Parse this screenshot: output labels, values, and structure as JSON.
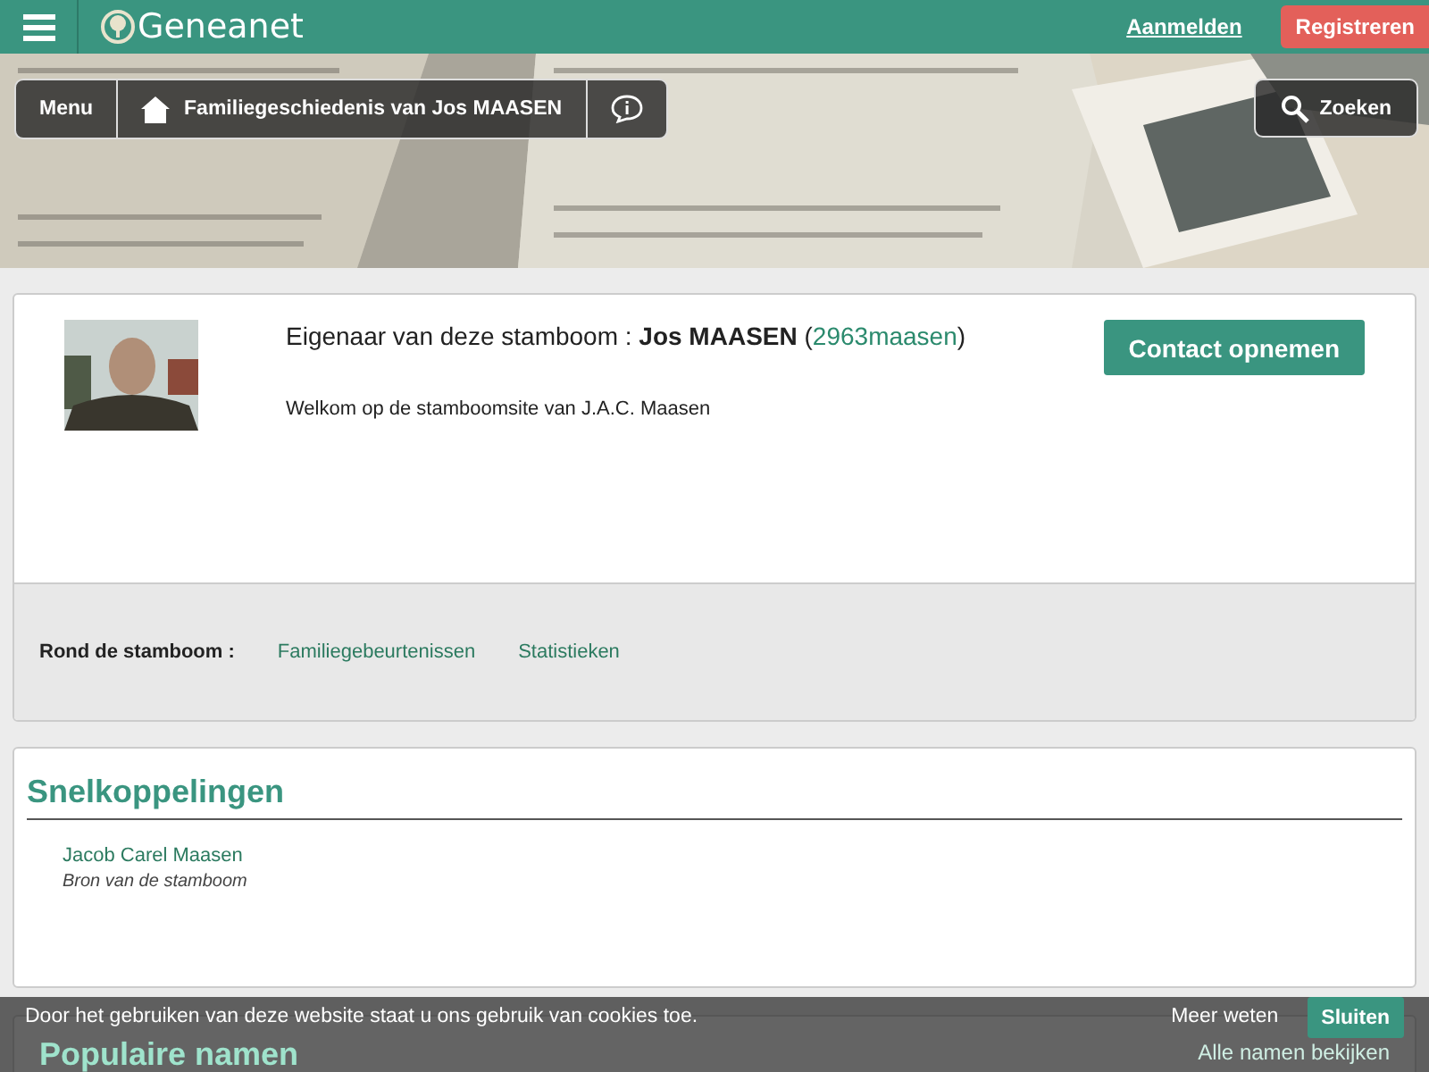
{
  "header": {
    "logo": "Geneanet",
    "login": "Aanmelden",
    "register": "Registreren"
  },
  "banner": {
    "menu": "Menu",
    "tree_title": "Familiegeschiedenis van Jos MAASEN",
    "search": "Zoeken"
  },
  "owner": {
    "label": "Eigenaar van deze stamboom : ",
    "name": "Jos MAASEN",
    "user_open": "(",
    "user": "2963maasen",
    "user_close": ")",
    "welcome": "Welkom op de stamboomsite van J.A.C. Maasen",
    "contact": "Contact opnemen"
  },
  "around": {
    "label": "Rond de stamboom :",
    "links": [
      "Familiegebeurtenissen",
      "Statistieken"
    ]
  },
  "shortcuts": {
    "title": "Snelkoppelingen",
    "items": [
      {
        "name": "Jacob Carel Maasen",
        "note": "Bron van de stamboom"
      }
    ]
  },
  "popular": {
    "title": "Populaire namen",
    "all": "Alle namen bekijken"
  },
  "cookie": {
    "text": "Door het gebruiken van deze website staat u ons gebruik van cookies toe.",
    "more": "Meer weten",
    "close": "Sluiten"
  }
}
